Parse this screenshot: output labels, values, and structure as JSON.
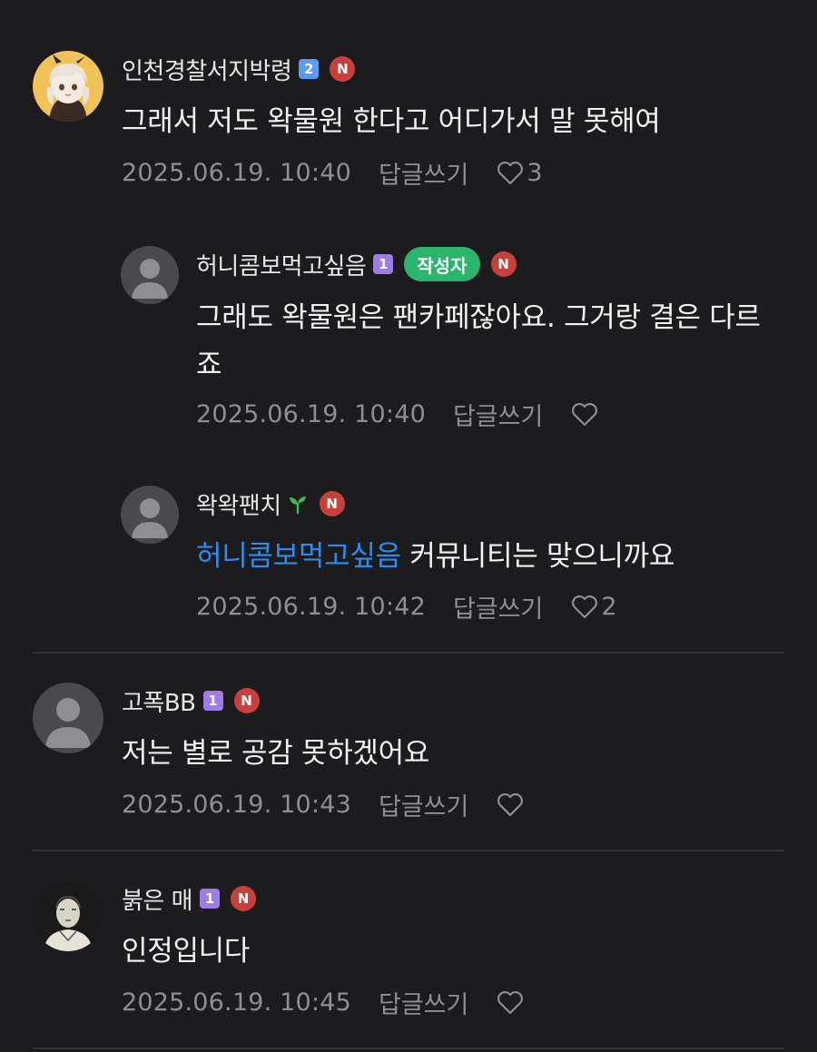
{
  "comments": [
    {
      "nickname": "인천경찰서지박령",
      "level": "2",
      "n_badge": "N",
      "text": "그래서 저도 왁물원 한다고 어디가서 말 못해여",
      "date": "2025.06.19. 10:40",
      "reply_label": "답글쓰기",
      "likes": "3"
    },
    {
      "nickname": "허니콤보먹고싶음",
      "level": "1",
      "author_badge": "작성자",
      "n_badge": "N",
      "text": "그래도 왁물원은 팬카페잖아요. 그거랑 결은 다르죠",
      "date": "2025.06.19. 10:40",
      "reply_label": "답글쓰기",
      "likes": ""
    },
    {
      "nickname": "왁왁팬치",
      "n_badge": "N",
      "mention": "허니콤보먹고싶음",
      "text": "커뮤니티는 맞으니까요",
      "date": "2025.06.19. 10:42",
      "reply_label": "답글쓰기",
      "likes": "2"
    },
    {
      "nickname": "고폭BB",
      "level": "1",
      "n_badge": "N",
      "text": "저는 별로 공감 못하겠어요",
      "date": "2025.06.19. 10:43",
      "reply_label": "답글쓰기",
      "likes": ""
    },
    {
      "nickname": "붉은 매",
      "level": "1",
      "n_badge": "N",
      "text": "인정입니다",
      "date": "2025.06.19. 10:45",
      "reply_label": "답글쓰기",
      "likes": ""
    }
  ],
  "colors": {
    "background": "#1c1c1e",
    "mention": "#2d8cf0",
    "author_badge": "#2bb46c",
    "n_badge": "#c9403a",
    "level1": "#9d7ce8",
    "level2": "#5b9cf5",
    "meta": "#8e8e93"
  }
}
